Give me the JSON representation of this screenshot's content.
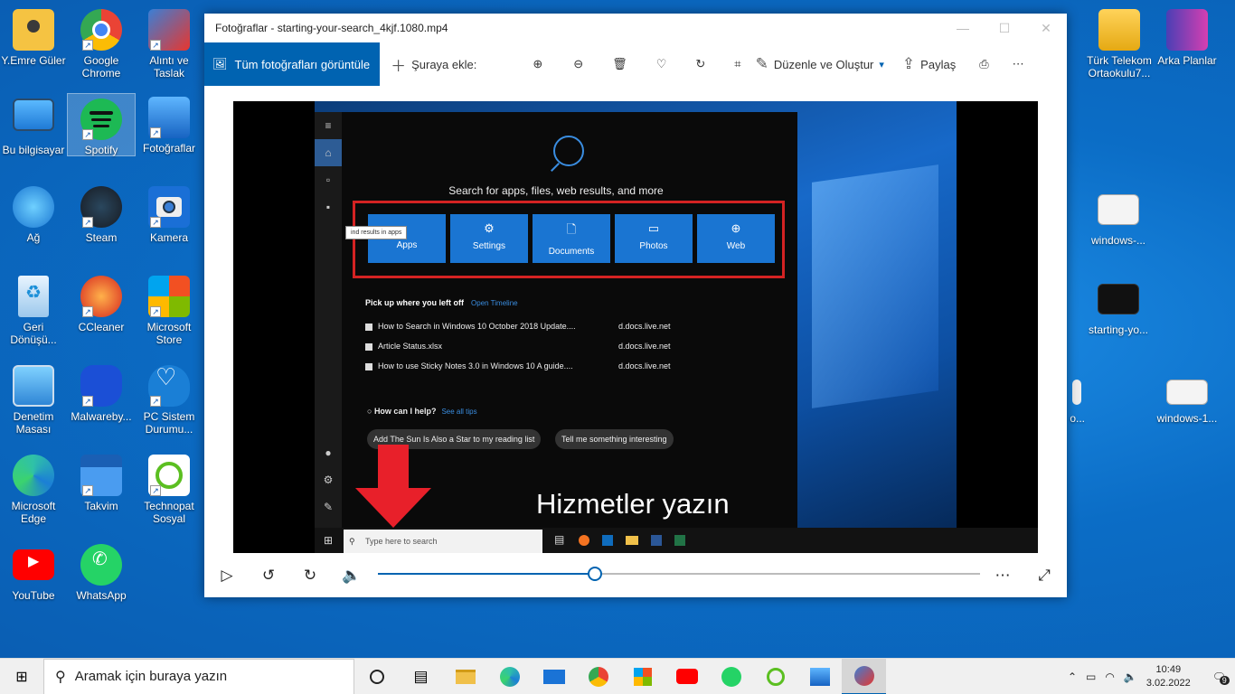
{
  "desktop_icons": {
    "col1": [
      {
        "label": "Y.Emre Güler",
        "icon": "user-folder-icon"
      },
      {
        "label": "Bu bilgisayar",
        "icon": "computer-icon"
      },
      {
        "label": "Ağ",
        "icon": "network-icon"
      },
      {
        "label": "Geri Dönüşü...",
        "icon": "recycle-bin-icon"
      },
      {
        "label": "Denetim Masası",
        "icon": "control-panel-icon"
      },
      {
        "label": "Microsoft Edge",
        "icon": "edge-icon"
      },
      {
        "label": "YouTube",
        "icon": "youtube-icon"
      }
    ],
    "col2": [
      {
        "label": "Google Chrome",
        "icon": "chrome-icon"
      },
      {
        "label": "Spotify",
        "icon": "spotify-icon"
      },
      {
        "label": "Steam",
        "icon": "steam-icon"
      },
      {
        "label": "CCleaner",
        "icon": "ccleaner-icon"
      },
      {
        "label": "Malwareby...",
        "icon": "malwarebytes-icon"
      },
      {
        "label": "Takvim",
        "icon": "calendar-icon"
      },
      {
        "label": "WhatsApp",
        "icon": "whatsapp-icon"
      }
    ],
    "col3": [
      {
        "label": "Alıntı ve Taslak",
        "icon": "snip-icon"
      },
      {
        "label": "Fotoğraflar",
        "icon": "photos-icon"
      },
      {
        "label": "Kamera",
        "icon": "camera-icon"
      },
      {
        "label": "Microsoft Store",
        "icon": "store-icon"
      },
      {
        "label": "PC Sistem Durumu...",
        "icon": "pc-health-icon"
      },
      {
        "label": "Technopat Sosyal",
        "icon": "technopat-icon"
      }
    ],
    "right": [
      {
        "label": "Türk Telekom Ortaokulu7...",
        "icon": "folder-icon"
      },
      {
        "label": "Arka Planlar",
        "icon": "folder-icon"
      },
      {
        "label": "windows-...",
        "icon": "image-file-icon"
      },
      {
        "label": "starting-yo...",
        "icon": "video-file-icon"
      },
      {
        "label": "windows-1...",
        "icon": "image-file-icon"
      },
      {
        "label": "o...",
        "icon": "file-icon"
      }
    ]
  },
  "window": {
    "title": "Fotoğraflar - starting-your-search_4kjf.1080.mp4",
    "toolbar": {
      "view_all": "Tüm fotoğrafları görüntüle",
      "add_to": "Şuraya ekle:",
      "edit_create": "Düzenle ve Oluştur",
      "share": "Paylaş"
    }
  },
  "video": {
    "search_title": "Search for apps, files, web results, and more",
    "tiles": [
      "Apps",
      "Settings",
      "Documents",
      "Photos",
      "Web"
    ],
    "tooltip": "ind results in apps",
    "pickup": "Pick up where you left off",
    "open_timeline": "Open Timeline",
    "recent": [
      {
        "name": "How to Search in Windows 10 October 2018 Update....",
        "source": "d.docs.live.net"
      },
      {
        "name": "Article Status.xlsx",
        "source": "d.docs.live.net"
      },
      {
        "name": "How to use Sticky Notes 3.0 in Windows 10 A guide....",
        "source": "d.docs.live.net"
      }
    ],
    "help": "How can I help?",
    "see_tips": "See all tips",
    "chip1": "Add The Sun Is Also a Star to my reading list",
    "chip2": "Tell me something interesting",
    "taskbar_search": "Type here to search",
    "caption": "Hizmetler yazın"
  },
  "playback": {
    "progress": 0.36
  },
  "taskbar": {
    "search_placeholder": "Aramak için buraya yazın",
    "time": "10:49",
    "date": "3.02.2022",
    "notification_count": "9"
  }
}
